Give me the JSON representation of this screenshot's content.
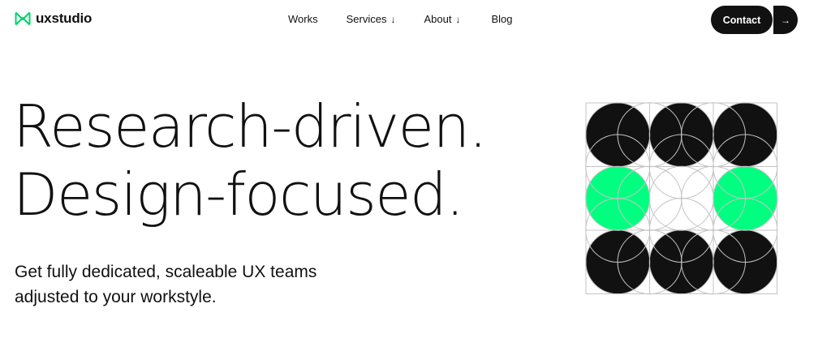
{
  "brand": {
    "name": "uxstudio",
    "accent": "#00ff80"
  },
  "nav": {
    "works": "Works",
    "services": "Services",
    "about": "About",
    "blog": "Blog",
    "dropdown_glyph": "↓"
  },
  "cta": {
    "label": "Contact",
    "arrow_glyph": "→"
  },
  "hero": {
    "line1": "Research-driven.",
    "line2": "Design-focused.",
    "sub_line1": "Get fully dedicated, scaleable UX teams",
    "sub_line2": "adjusted to your workstyle."
  },
  "graphic": {
    "grid": [
      [
        "black",
        "black",
        "black"
      ],
      [
        "green",
        "empty",
        "green"
      ],
      [
        "black",
        "black",
        "black"
      ]
    ],
    "colors": {
      "black": "#111111",
      "green": "#00ff80",
      "line": "#c4c4c4"
    }
  }
}
